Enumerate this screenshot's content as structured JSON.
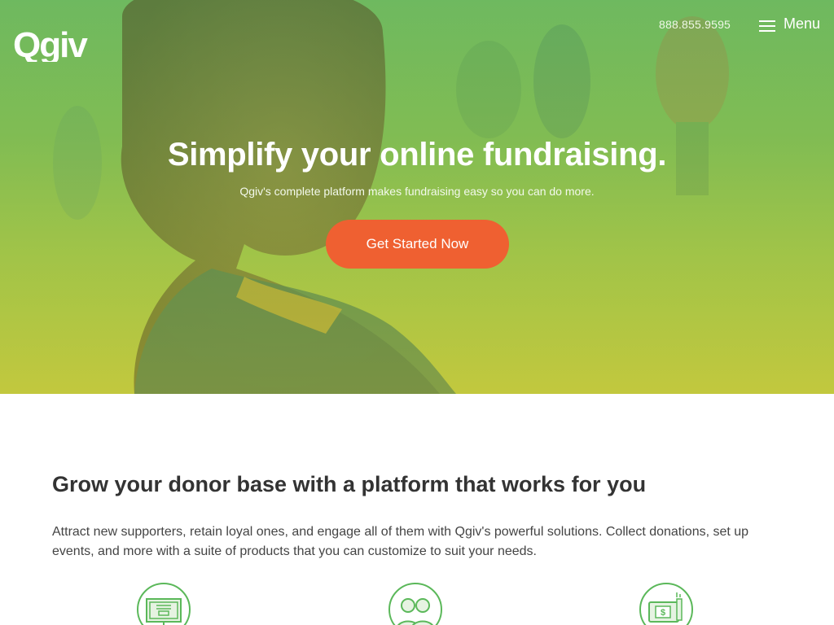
{
  "header": {
    "logo_text": "Qgiv",
    "phone": "888.855.9595",
    "menu_label": "Menu"
  },
  "hero": {
    "title": "Simplify your online fundraising.",
    "subtitle": "Qgiv's complete platform makes fundraising easy so you can do more.",
    "cta_label": "Get Started Now"
  },
  "intro": {
    "title": "Grow your donor base with a platform that works for you",
    "body": "Attract new supporters, retain loyal ones, and engage all of them with Qgiv's powerful solutions. Collect donations, set up events, and more with a suite of products that you can customize to suit your needs."
  },
  "features": [
    {
      "icon": "online-form-icon"
    },
    {
      "icon": "supporters-icon"
    },
    {
      "icon": "payment-device-icon"
    }
  ],
  "colors": {
    "brand_green": "#5bb85a",
    "cta_orange": "#ef6031",
    "hero_green": "#6fb85e",
    "hero_yellow": "#bcc83f"
  }
}
